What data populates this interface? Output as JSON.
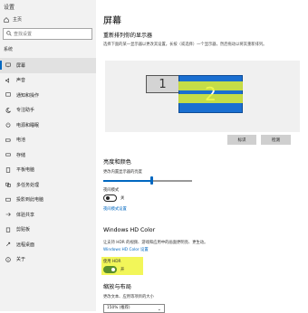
{
  "sidebar": {
    "app_title": "设置",
    "home_label": "主页",
    "search_placeholder": "查找设置",
    "section_label": "系统",
    "items": [
      {
        "label": "屏幕",
        "active": true
      },
      {
        "label": "声音"
      },
      {
        "label": "通知和操作"
      },
      {
        "label": "专注助手"
      },
      {
        "label": "电源和睡眠"
      },
      {
        "label": "电池"
      },
      {
        "label": "存储"
      },
      {
        "label": "平板电脑"
      },
      {
        "label": "多任务处理"
      },
      {
        "label": "投影到此电脑"
      },
      {
        "label": "体验共享"
      },
      {
        "label": "剪贴板"
      },
      {
        "label": "远程桌面"
      },
      {
        "label": "关于"
      }
    ]
  },
  "main": {
    "title": "屏幕",
    "rearrange_heading": "重新排列你的显示器",
    "rearrange_desc": "选择下面的某一显示器以更改其设置。长按（或选择）一个显示器，然后拖动以将其重新排列。",
    "monitor1_label": "1",
    "monitor2_label": "2",
    "identify_button": "标识",
    "detect_button": "检测",
    "brightness_heading": "亮度和颜色",
    "brightness_label": "更改内置显示器的亮度",
    "brightness_value": 0.55,
    "night_light_label": "夜间模式",
    "night_light_state": "关",
    "night_light_link": "夜间模式设置",
    "hd_color_heading": "Windows HD Color",
    "hd_color_desc": "让支持 HDR 的视频、游戏和应用中的画面更明亮、更生动。",
    "hd_color_link": "Windows HD Color 设置",
    "hdr_label": "使用 HDR",
    "hdr_state": "开",
    "scale_heading": "缩放与布局",
    "scale_desc": "更改文本、应用等项目的大小",
    "scale_value": "150% (推荐)"
  },
  "colors": {
    "accent": "#0067c0",
    "monitor_selected": "#1a6fd1",
    "highlight": "#ebf528"
  }
}
